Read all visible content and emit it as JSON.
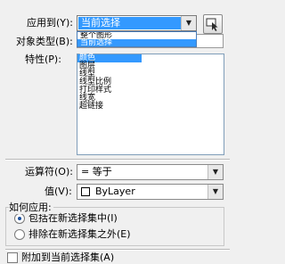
{
  "apply_to": {
    "label": "应用到(Y):",
    "value": "当前选择",
    "options": [
      "整个图形",
      "当前选择"
    ]
  },
  "object_type": {
    "label": "对象类型(B):"
  },
  "properties": {
    "label": "特性(P):",
    "items": [
      "颜色",
      "图层",
      "线型",
      "线型比例",
      "打印样式",
      "线宽",
      "超链接"
    ],
    "selected_index": 0
  },
  "operator": {
    "label": "运算符(O):",
    "value": "= 等于"
  },
  "value": {
    "label": "值(V):",
    "value": "ByLayer"
  },
  "how_to_apply": {
    "label": "如何应用:",
    "include_label": "包括在新选择集中(I)",
    "exclude_label": "排除在新选择集之外(E)",
    "include_selected": true
  },
  "append": {
    "label": "附加到当前选择集(A)",
    "checked": false
  }
}
